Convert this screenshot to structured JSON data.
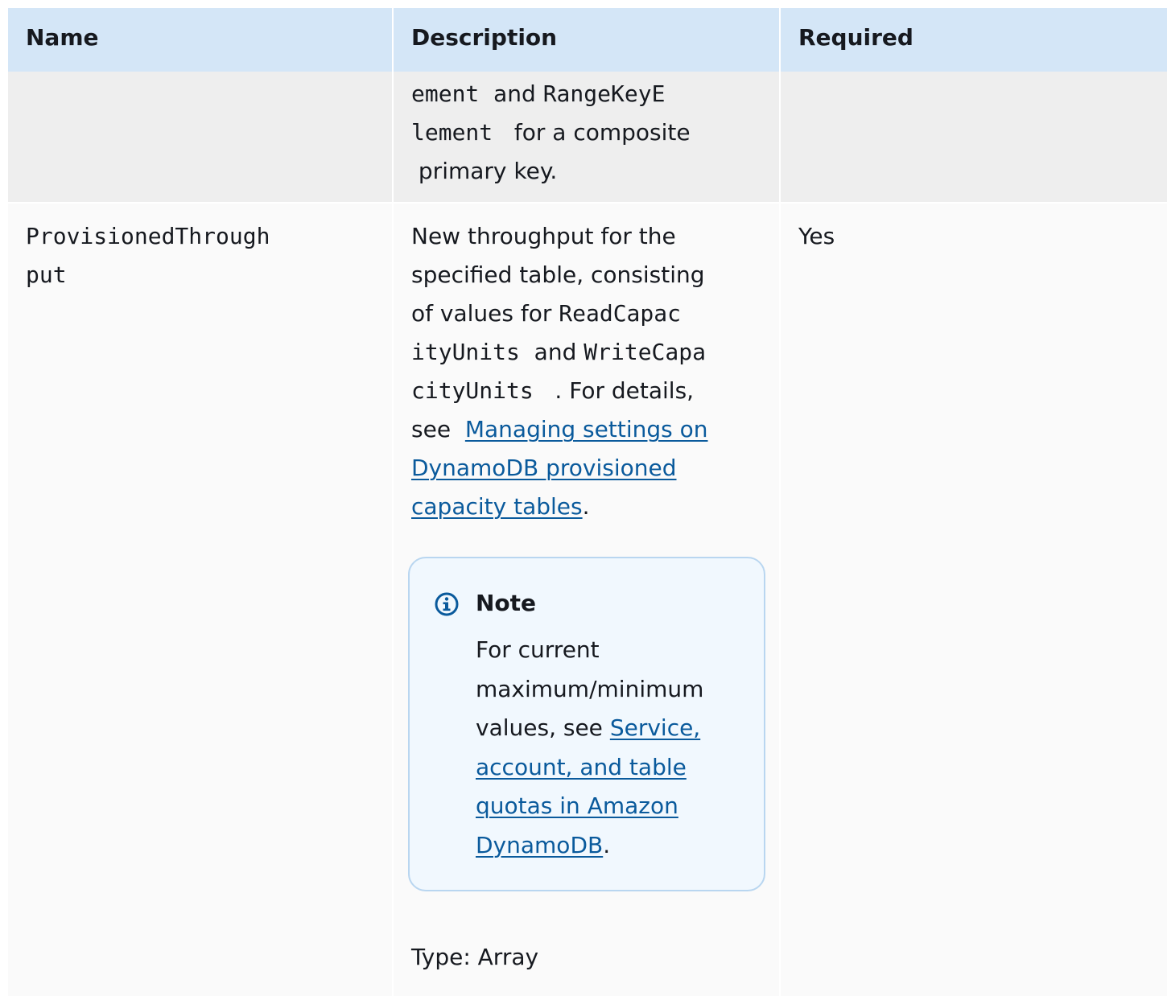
{
  "header": {
    "name": "Name",
    "description": "Description",
    "required": "Required"
  },
  "row_key_schema": {
    "desc_line1_code": "ement",
    "desc_line1_text": "and",
    "desc_line1_code2": "RangeKeyE",
    "desc_line2_code": "lement",
    "desc_line2_text": "for a composite",
    "desc_line3_text": "primary key."
  },
  "row_throughput": {
    "name_line1": "ProvisionedThrough",
    "name_line2": "put",
    "desc_line1": "New throughput for the",
    "desc_line2": "specified table, consisting",
    "desc_line3_text": "of values for",
    "desc_line3_code": "ReadCapac",
    "desc_line4_code": "ityUnits",
    "desc_line4_text": "and",
    "desc_line4_code2": "WriteCapa",
    "desc_line5_code": "cityUnits",
    "desc_line5_text": ". For details,",
    "desc_line6_text": "see",
    "link1_line1": "Managing settings on",
    "link1_line2": "DynamoDB provisioned",
    "link1_line3": "capacity tables",
    "period": ".",
    "required": "Yes",
    "note": {
      "icon": "info-icon",
      "title": "Note",
      "body_line1": "For current",
      "body_line2": "maximum/minimum",
      "body_line3": "values, see",
      "link_line1": "Service,",
      "link_line2": "account, and table",
      "link_line3": "quotas in Amazon",
      "link_line4": "DynamoDB",
      "period": "."
    },
    "type": "Type: Array"
  },
  "colors": {
    "header_bg": "#d4e6f7",
    "link": "#0a5a9c",
    "note_border": "#b9d6f0",
    "note_bg": "#f1f8fe",
    "info_icon": "#0a5a9c"
  }
}
